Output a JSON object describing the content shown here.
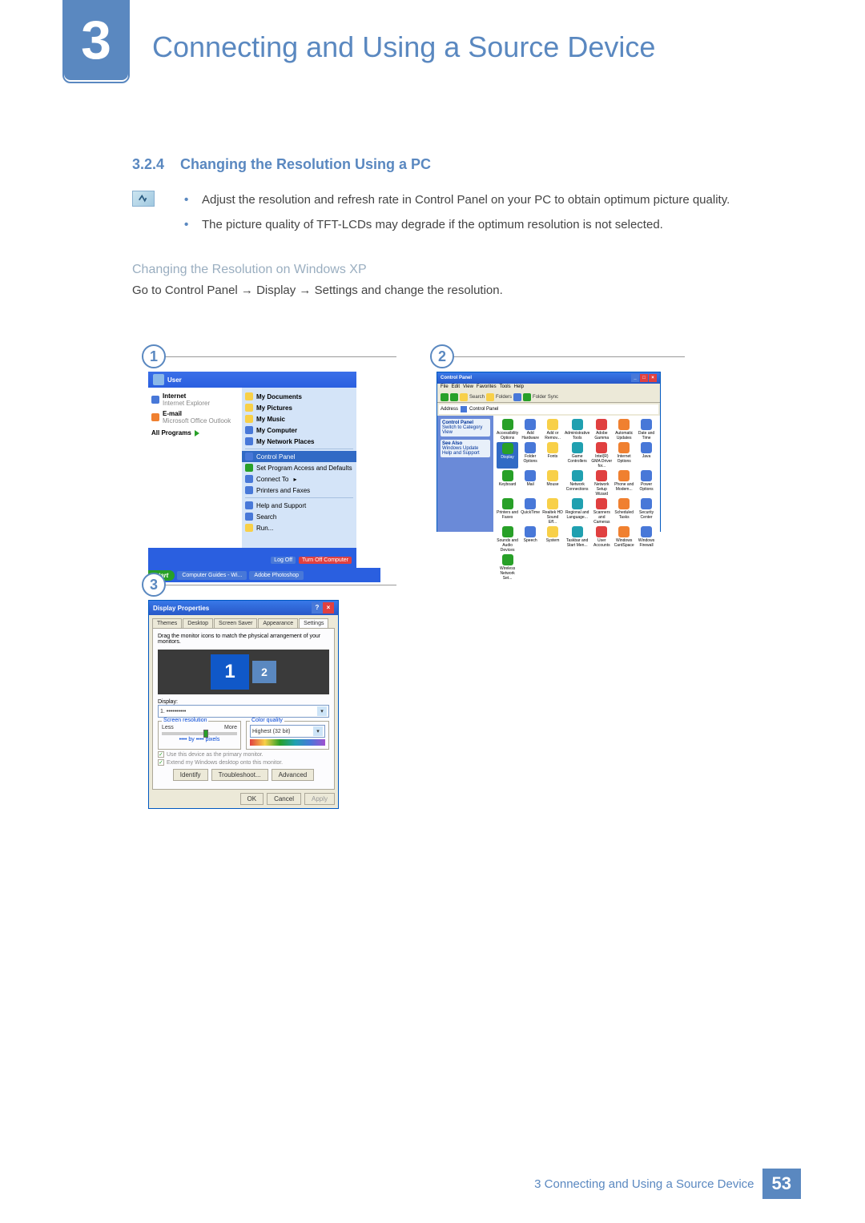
{
  "chapter": {
    "number": "3",
    "title": "Connecting and Using a Source Device"
  },
  "section": {
    "number": "3.2.4",
    "title": "Changing the Resolution Using a PC"
  },
  "notes": {
    "b1": "Adjust the resolution and refresh rate in Control Panel on your PC to obtain optimum picture quality.",
    "b2": "The picture quality of TFT-LCDs may degrade if the optimum resolution is not selected."
  },
  "subsection": "Changing the Resolution on Windows XP",
  "instruction": "Go to Control Panel → Display → Settings and change the resolution.",
  "figs": {
    "n1": "1",
    "n2": "2",
    "n3": "3"
  },
  "startmenu": {
    "user": "User",
    "left": {
      "internet": "Internet",
      "internet_sub": "Internet Explorer",
      "email": "E-mail",
      "email_sub": "Microsoft Office Outlook",
      "all": "All Programs"
    },
    "right": {
      "docs": "My Documents",
      "pics": "My Pictures",
      "music": "My Music",
      "computer": "My Computer",
      "network": "My Network Places",
      "cpanel": "Control Panel",
      "access": "Set Program Access and Defaults",
      "connect": "Connect To",
      "printers": "Printers and Faxes",
      "help": "Help and Support",
      "search": "Search",
      "run": "Run..."
    },
    "logoff": "Log Off",
    "turnoff": "Turn Off Computer",
    "start": "start",
    "tb1": "Computer Guides - Wi...",
    "tb2": "Adobe Photoshop"
  },
  "cpanel": {
    "title": "Control Panel",
    "menu": {
      "file": "File",
      "edit": "Edit",
      "view": "View",
      "fav": "Favorites",
      "tools": "Tools",
      "help": "Help"
    },
    "toolbar": {
      "search": "Search",
      "folders": "Folders",
      "sync": "Folder Sync"
    },
    "address_label": "Address",
    "address": "Control Panel",
    "side": {
      "head": "Control Panel",
      "switch": "Switch to Category View",
      "see": "See Also",
      "wu": "Windows Update",
      "hs": "Help and Support"
    },
    "icons": {
      "i0": "Accessibility Options",
      "i1": "Add Hardware",
      "i2": "Add or Remov...",
      "i3": "Administrative Tools",
      "i4": "Adobe Gamma",
      "i5": "Automatic Updates",
      "i6": "Date and Time",
      "i7": "Display",
      "i8": "Folder Options",
      "i9": "Fonts",
      "i10": "Game Controllers",
      "i11": "Intel(R) GMA Driver for...",
      "i12": "Internet Options",
      "i13": "Java",
      "i14": "Keyboard",
      "i15": "Mail",
      "i16": "Mouse",
      "i17": "Network Connections",
      "i18": "Network Setup Wizard",
      "i19": "Phone and Modem...",
      "i20": "Power Options",
      "i21": "Printers and Faxes",
      "i22": "QuickTime",
      "i23": "Realtek HD Sound Eff...",
      "i24": "Regional and Language...",
      "i25": "Scanners and Cameras",
      "i26": "Scheduled Tasks",
      "i27": "Security Center",
      "i28": "Sounds and Audio Devices",
      "i29": "Speech",
      "i30": "System",
      "i31": "Taskbar and Start Men...",
      "i32": "User Accounts",
      "i33": "Windows CardSpace",
      "i34": "Windows Firewall",
      "i35": "Wireless Network Set..."
    }
  },
  "display": {
    "title": "Display Properties",
    "tabs": {
      "themes": "Themes",
      "desktop": "Desktop",
      "ss": "Screen Saver",
      "appearance": "Appearance",
      "settings": "Settings"
    },
    "hint": "Drag the monitor icons to match the physical arrangement of your monitors.",
    "mon1": "1",
    "mon2": "2",
    "display_label": "Display:",
    "display_value": "1. ••••••••••",
    "res_group": "Screen resolution",
    "less": "Less",
    "more": "More",
    "res_value": "•••• by •••• pixels",
    "color_group": "Color quality",
    "color_value": "Highest (32 bit)",
    "ck1": "Use this device as the primary monitor.",
    "ck2": "Extend my Windows desktop onto this monitor.",
    "identify": "Identify",
    "troubleshoot": "Troubleshoot...",
    "advanced": "Advanced",
    "ok": "OK",
    "cancel": "Cancel",
    "apply": "Apply"
  },
  "footer": {
    "chapter": "3 Connecting and Using a Source Device",
    "page": "53"
  }
}
